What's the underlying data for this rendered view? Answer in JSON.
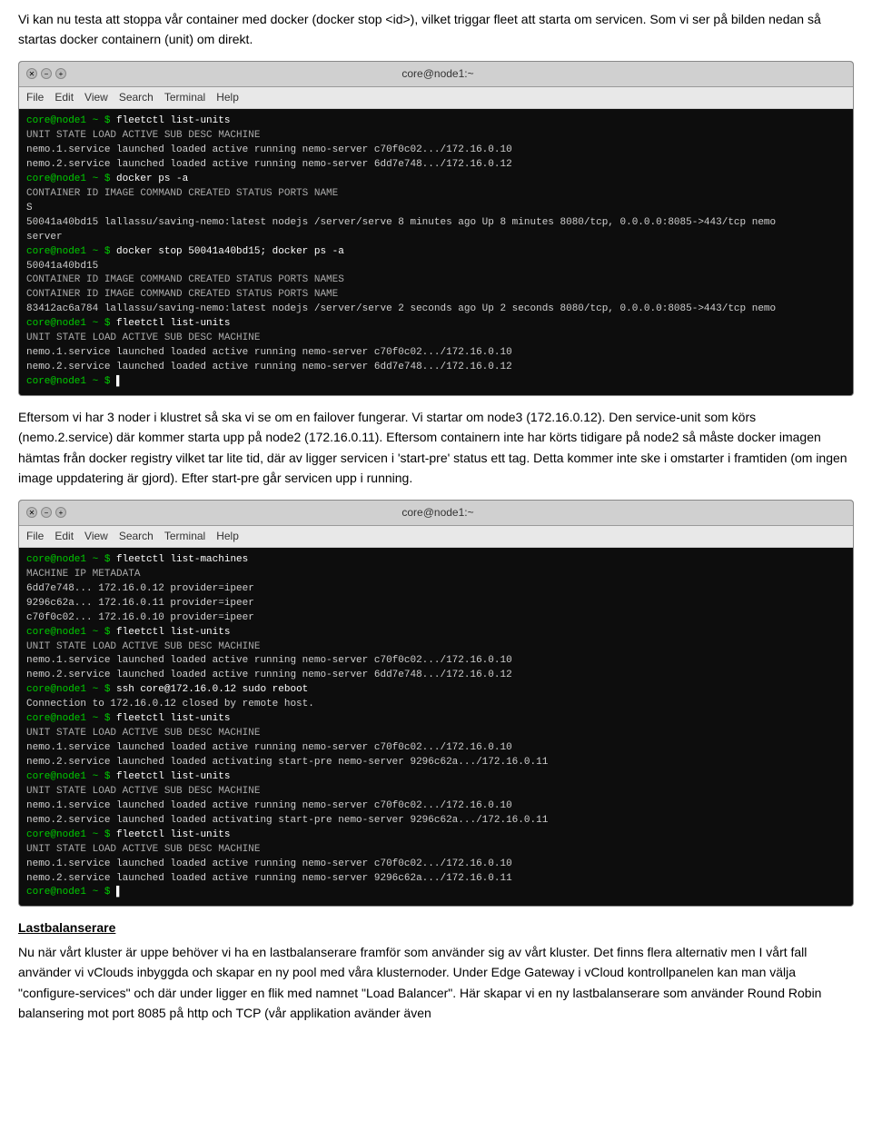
{
  "intro_text": "Vi kan nu testa att stoppa vår container med docker (docker stop <id>), vilket triggar fleet att starta om servicen. Som vi ser på bilden nedan så startas docker containern (unit) om direkt.",
  "terminal1": {
    "title": "core@node1:~",
    "menu": [
      "File",
      "Edit",
      "View",
      "Search",
      "Terminal",
      "Help"
    ],
    "lines": [
      {
        "type": "prompt",
        "text": "core@node1 ~ $ fleetctl list-units"
      },
      {
        "type": "header",
        "text": "UNIT                STATE       LOAD       ACTIVE    SUB       DESC              MACHINE"
      },
      {
        "type": "data",
        "text": "nemo.1.service      launched    loaded     active    running   nemo-server       c70f0c02.../172.16.0.10"
      },
      {
        "type": "data",
        "text": "nemo.2.service      launched    loaded     active    running   nemo-server       6dd7e748.../172.16.0.12"
      },
      {
        "type": "prompt",
        "text": "core@node1 ~ $ docker ps -a"
      },
      {
        "type": "header",
        "text": "CONTAINER ID    IMAGE                         COMMAND              CREATED           STATUS        PORTS                            NAME"
      },
      {
        "type": "data",
        "text": "S"
      },
      {
        "type": "data",
        "text": "50041a40bd15    lallassu/saving-nemo:latest   nodejs /server/serve  8 minutes ago     Up 8 minutes  8080/tcp, 0.0.0.0:8085->443/tcp  nemo"
      },
      {
        "type": "data",
        "text": "server"
      },
      {
        "type": "prompt",
        "text": "core@node1 ~ $ docker stop 50041a40bd15; docker ps -a"
      },
      {
        "type": "data",
        "text": "50041a40bd15"
      },
      {
        "type": "header",
        "text": "CONTAINER ID    IMAGE                         COMMAND              CREATED           STATUS        PORTS                            NAMES"
      },
      {
        "type": "header",
        "text": "CONTAINER ID    IMAGE                         COMMAND              CREATED           STATUS        PORTS                            NAME"
      },
      {
        "type": "data",
        "text": "83412ac6a784    lallassu/saving-nemo:latest   nodejs /server/serve  2 seconds ago     Up 2 seconds  8080/tcp, 0.0.0.0:8085->443/tcp  nemo"
      },
      {
        "type": "prompt",
        "text": "core@node1 ~ $ fleetctl list-units"
      },
      {
        "type": "header",
        "text": "UNIT                STATE       LOAD       ACTIVE    SUB       DESC              MACHINE"
      },
      {
        "type": "data",
        "text": "nemo.1.service      launched    loaded     active    running   nemo-server       c70f0c02.../172.16.0.10"
      },
      {
        "type": "data",
        "text": "nemo.2.service      launched    loaded     active    running   nemo-server       6dd7e748.../172.16.0.12"
      },
      {
        "type": "prompt",
        "text": "core@node1 ~ $ ▌"
      }
    ]
  },
  "mid_text1": "Eftersom vi har 3 noder i klustret så ska vi se om en failover fungerar. Vi startar om node3 (172.16.0.12). Den service-unit som körs (nemo.2.service) där kommer starta upp på node2 (172.16.0.11). Eftersom containern inte har körts tidigare på node2 så måste docker imagen hämtas från docker registry vilket tar lite tid, där av ligger servicen i 'start-pre' status ett tag. Detta kommer inte ske i omstarter i framtiden (om ingen image uppdatering är gjord). Efter start-pre går servicen upp i running.",
  "terminal2": {
    "title": "core@node1:~",
    "menu": [
      "File",
      "Edit",
      "View",
      "Search",
      "Terminal",
      "Help"
    ],
    "lines": [
      {
        "type": "prompt",
        "text": "core@node1 ~ $ fleetctl list-machines"
      },
      {
        "type": "header",
        "text": "MACHINE       IP            METADATA"
      },
      {
        "type": "data",
        "text": "6dd7e748...   172.16.0.12   provider=ipeer"
      },
      {
        "type": "data",
        "text": "9296c62a...   172.16.0.11   provider=ipeer"
      },
      {
        "type": "data",
        "text": "c70f0c02...   172.16.0.10   provider=ipeer"
      },
      {
        "type": "prompt",
        "text": "core@node1 ~ $ fleetctl list-units"
      },
      {
        "type": "header",
        "text": "UNIT                STATE       LOAD       ACTIVE    SUB       DESC              MACHINE"
      },
      {
        "type": "data",
        "text": "nemo.1.service      launched    loaded     active    running   nemo-server       c70f0c02.../172.16.0.10"
      },
      {
        "type": "data",
        "text": "nemo.2.service      launched    loaded     active    running   nemo-server       6dd7e748.../172.16.0.12"
      },
      {
        "type": "prompt",
        "text": "core@node1 ~ $ ssh core@172.16.0.12 sudo reboot"
      },
      {
        "type": "data",
        "text": "Connection to 172.16.0.12 closed by remote host."
      },
      {
        "type": "prompt",
        "text": "core@node1 ~ $ fleetctl list-units"
      },
      {
        "type": "header",
        "text": "UNIT                STATE       LOAD       ACTIVE      SUB         DESC              MACHINE"
      },
      {
        "type": "data",
        "text": "nemo.1.service      launched    loaded     active      running     nemo-server       c70f0c02.../172.16.0.10"
      },
      {
        "type": "data",
        "text": "nemo.2.service      launched    loaded     activating  start-pre   nemo-server       9296c62a.../172.16.0.11"
      },
      {
        "type": "prompt",
        "text": "core@node1 ~ $ fleetctl list-units"
      },
      {
        "type": "header",
        "text": "UNIT                STATE       LOAD       ACTIVE      SUB         DESC              MACHINE"
      },
      {
        "type": "data",
        "text": "nemo.1.service      launched    loaded     active      running     nemo-server       c70f0c02.../172.16.0.10"
      },
      {
        "type": "data",
        "text": "nemo.2.service      launched    loaded     activating  start-pre   nemo-server       9296c62a.../172.16.0.11"
      },
      {
        "type": "prompt",
        "text": "core@node1 ~ $ fleetctl list-units"
      },
      {
        "type": "header",
        "text": "UNIT                STATE       LOAD       ACTIVE    SUB       DESC              MACHINE"
      },
      {
        "type": "data",
        "text": "nemo.1.service      launched    loaded     active    running   nemo-server       c70f0c02.../172.16.0.10"
      },
      {
        "type": "data",
        "text": "nemo.2.service      launched    loaded     active    running   nemo-server       9296c62a.../172.16.0.11"
      },
      {
        "type": "prompt",
        "text": "core@node1 ~ $ ▌"
      }
    ]
  },
  "section_heading": "Lastbalanserare",
  "bottom_text": "Nu när vårt kluster är uppe behöver vi ha en lastbalanserare framför som använder sig av vårt kluster. Det finns flera alternativ men I vårt fall använder vi vClouds inbyggda och skapar en ny pool med våra klusternoder. Under Edge Gateway i vCloud kontrollpanelen kan man välja \"configure-services\" och där under ligger en flik med namnet \"Load Balancer\". Här skapar vi en ny lastbalanserare som använder Round Robin balansering mot port 8085 på http och TCP (vår applikation avänder även"
}
